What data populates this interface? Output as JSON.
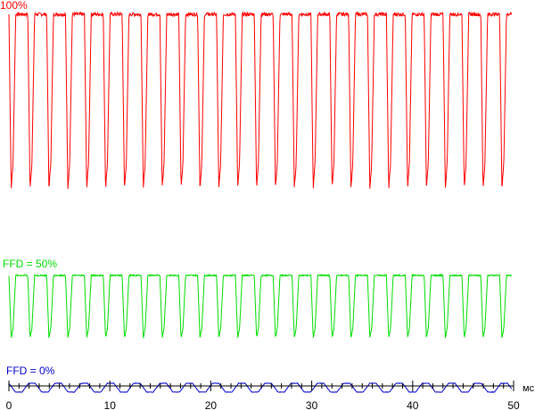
{
  "chart_data": {
    "type": "line",
    "xlabel": "мс",
    "xlim": [
      0,
      50
    ],
    "xticks": [
      0,
      10,
      20,
      30,
      40,
      50
    ],
    "grid": false,
    "legend_placement": "inline-left",
    "series": [
      {
        "name": "100%",
        "color": "#ff0000",
        "period_ms": 1.87,
        "start_ms": 0.0,
        "end_ms": 49.8,
        "high_level": 100,
        "low_level": 0,
        "pulse_count": 27
      },
      {
        "name": "FFD = 50%",
        "color": "#00dd00",
        "period_ms": 1.87,
        "start_ms": 0.0,
        "end_ms": 49.8,
        "high_level": 100,
        "low_level": 30,
        "pulse_count": 27
      },
      {
        "name": "FFD = 0%",
        "color": "#0000cc",
        "period_ms": 2.6,
        "start_ms": 0.0,
        "end_ms": 49.8,
        "high_level": 100,
        "low_level": 70,
        "pulse_count": 19
      }
    ]
  }
}
